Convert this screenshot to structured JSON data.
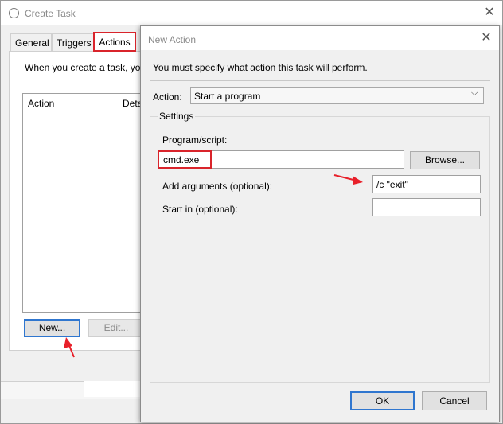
{
  "create_task": {
    "title": "Create Task",
    "tabs": [
      {
        "label": "General"
      },
      {
        "label": "Triggers"
      },
      {
        "label": "Actions"
      }
    ],
    "description": "When you create a task, yo",
    "columns": [
      "Action",
      "Deta"
    ],
    "buttons": {
      "new_label": "New...",
      "edit_label": "Edit..."
    },
    "close_glyph": "✕"
  },
  "new_action": {
    "title": "New Action",
    "close_glyph": "✕",
    "instruction": "You must specify what action this task will perform.",
    "action_label": "Action:",
    "action_value": "Start a program",
    "chevron_glyph": "⌵",
    "settings_label": "Settings",
    "program_label": "Program/script:",
    "program_value": "cmd.exe",
    "browse_label": "Browse...",
    "arguments_label": "Add arguments (optional):",
    "arguments_value": "/c \"exit\"",
    "start_in_label": "Start in (optional):",
    "start_in_value": "",
    "ok_label": "OK",
    "cancel_label": "Cancel"
  },
  "colors": {
    "highlight": "#d9242b",
    "focus": "#2f76cf",
    "annotation_arrow": "#e8202a"
  }
}
